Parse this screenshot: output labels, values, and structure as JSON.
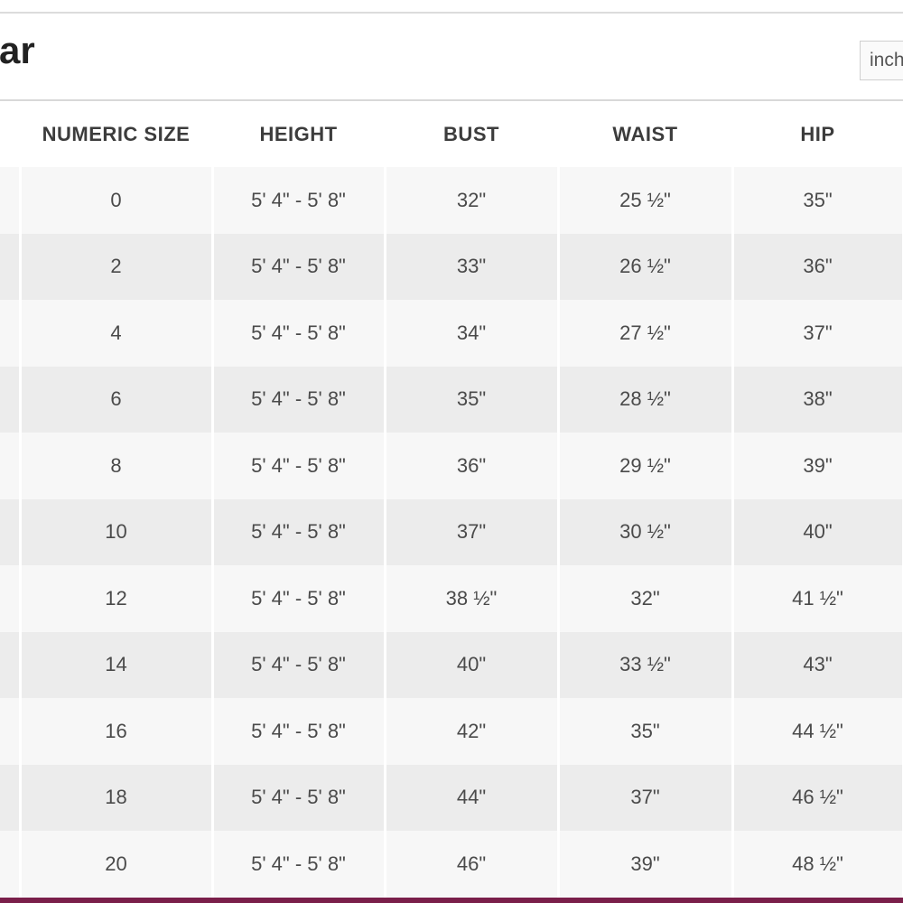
{
  "page": {
    "title": "ar",
    "unit_select_value": "inch"
  },
  "table": {
    "headers": [
      "",
      "NUMERIC SIZE",
      "HEIGHT",
      "BUST",
      "WAIST",
      "HIP"
    ],
    "rows": [
      [
        "",
        "0",
        "5' 4\" - 5' 8\"",
        "32\"",
        "25 ½\"",
        "35\""
      ],
      [
        "",
        "2",
        "5' 4\" - 5' 8\"",
        "33\"",
        "26 ½\"",
        "36\""
      ],
      [
        "",
        "4",
        "5' 4\" - 5' 8\"",
        "34\"",
        "27 ½\"",
        "37\""
      ],
      [
        "",
        "6",
        "5' 4\" - 5' 8\"",
        "35\"",
        "28 ½\"",
        "38\""
      ],
      [
        "",
        "8",
        "5' 4\" - 5' 8\"",
        "36\"",
        "29 ½\"",
        "39\""
      ],
      [
        "",
        "10",
        "5' 4\" - 5' 8\"",
        "37\"",
        "30 ½\"",
        "40\""
      ],
      [
        "",
        "12",
        "5' 4\" - 5' 8\"",
        "38 ½\"",
        "32\"",
        "41 ½\""
      ],
      [
        "",
        "14",
        "5' 4\" - 5' 8\"",
        "40\"",
        "33 ½\"",
        "43\""
      ],
      [
        "",
        "16",
        "5' 4\" - 5' 8\"",
        "42\"",
        "35\"",
        "44 ½\""
      ],
      [
        "",
        "18",
        "5' 4\" - 5' 8\"",
        "44\"",
        "37\"",
        "46 ½\""
      ],
      [
        "",
        "20",
        "5' 4\" - 5' 8\"",
        "46\"",
        "39\"",
        "48 ½\""
      ]
    ]
  },
  "colors": {
    "accent_bar": "#7a1f4a",
    "row_light": "#f7f7f7",
    "row_dark": "#ececec"
  }
}
